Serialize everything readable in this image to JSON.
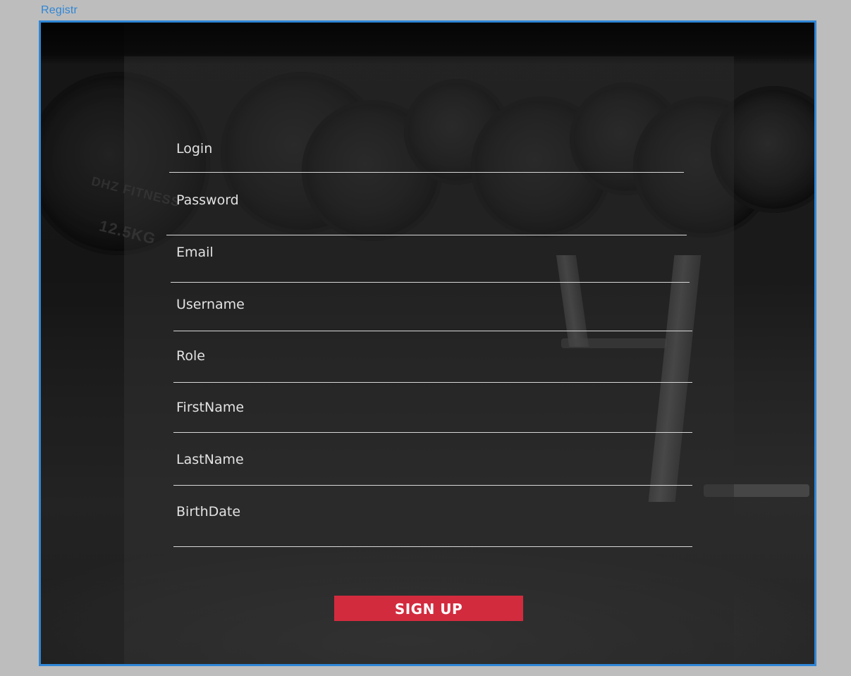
{
  "window": {
    "title": "Registr"
  },
  "form": {
    "fields": [
      {
        "key": "login",
        "label": "Login"
      },
      {
        "key": "password",
        "label": "Password"
      },
      {
        "key": "email",
        "label": "Email"
      },
      {
        "key": "username",
        "label": "Username"
      },
      {
        "key": "role",
        "label": "Role"
      },
      {
        "key": "firstname",
        "label": "FirstName"
      },
      {
        "key": "lastname",
        "label": "LastName"
      },
      {
        "key": "birthdate",
        "label": "BirthDate"
      }
    ],
    "submit_label": "SIGN UP"
  },
  "colors": {
    "accent": "#2f86d6",
    "button": "#d22b3e",
    "window_bg": "#bdbdbd"
  },
  "background": {
    "plate_text": [
      "DHZ FITNESS",
      "12.5KG"
    ]
  }
}
